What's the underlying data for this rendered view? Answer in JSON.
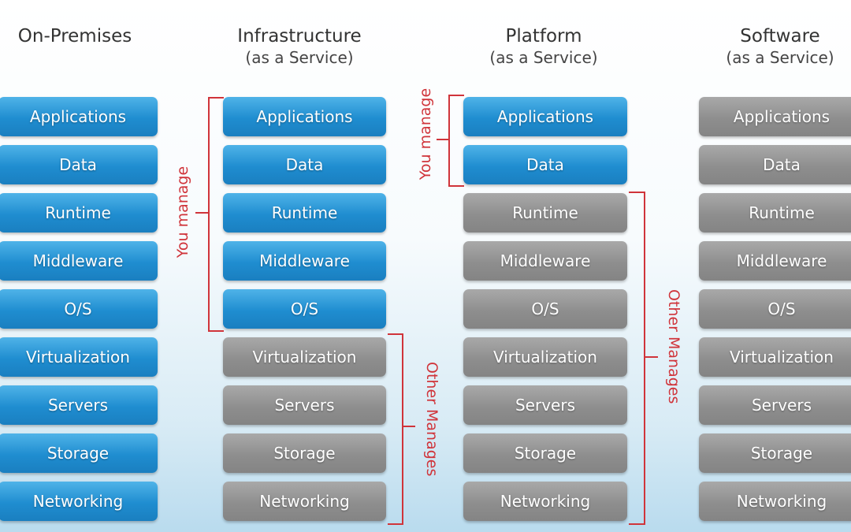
{
  "columns": [
    {
      "title": "On-Premises",
      "subtitle": "",
      "layers": [
        "Applications",
        "Data",
        "Runtime",
        "Middleware",
        "O/S",
        "Virtualization",
        "Servers",
        "Storage",
        "Networking"
      ],
      "you_manage_count": 9
    },
    {
      "title": "Infrastructure",
      "subtitle": "(as a Service)",
      "layers": [
        "Applications",
        "Data",
        "Runtime",
        "Middleware",
        "O/S",
        "Virtualization",
        "Servers",
        "Storage",
        "Networking"
      ],
      "you_manage_count": 5
    },
    {
      "title": "Platform",
      "subtitle": "(as a Service)",
      "layers": [
        "Applications",
        "Data",
        "Runtime",
        "Middleware",
        "O/S",
        "Virtualization",
        "Servers",
        "Storage",
        "Networking"
      ],
      "you_manage_count": 2
    },
    {
      "title": "Software",
      "subtitle": "(as a Service)",
      "layers": [
        "Applications",
        "Data",
        "Runtime",
        "Middleware",
        "O/S",
        "Virtualization",
        "Servers",
        "Storage",
        "Networking"
      ],
      "you_manage_count": 0
    }
  ],
  "labels": {
    "you_manage": "You manage",
    "other_manages": "Other Manages"
  },
  "colors": {
    "you_manage": "#1f8dd0",
    "other_manages": "#8e8e8e",
    "bracket": "#d0343a"
  }
}
